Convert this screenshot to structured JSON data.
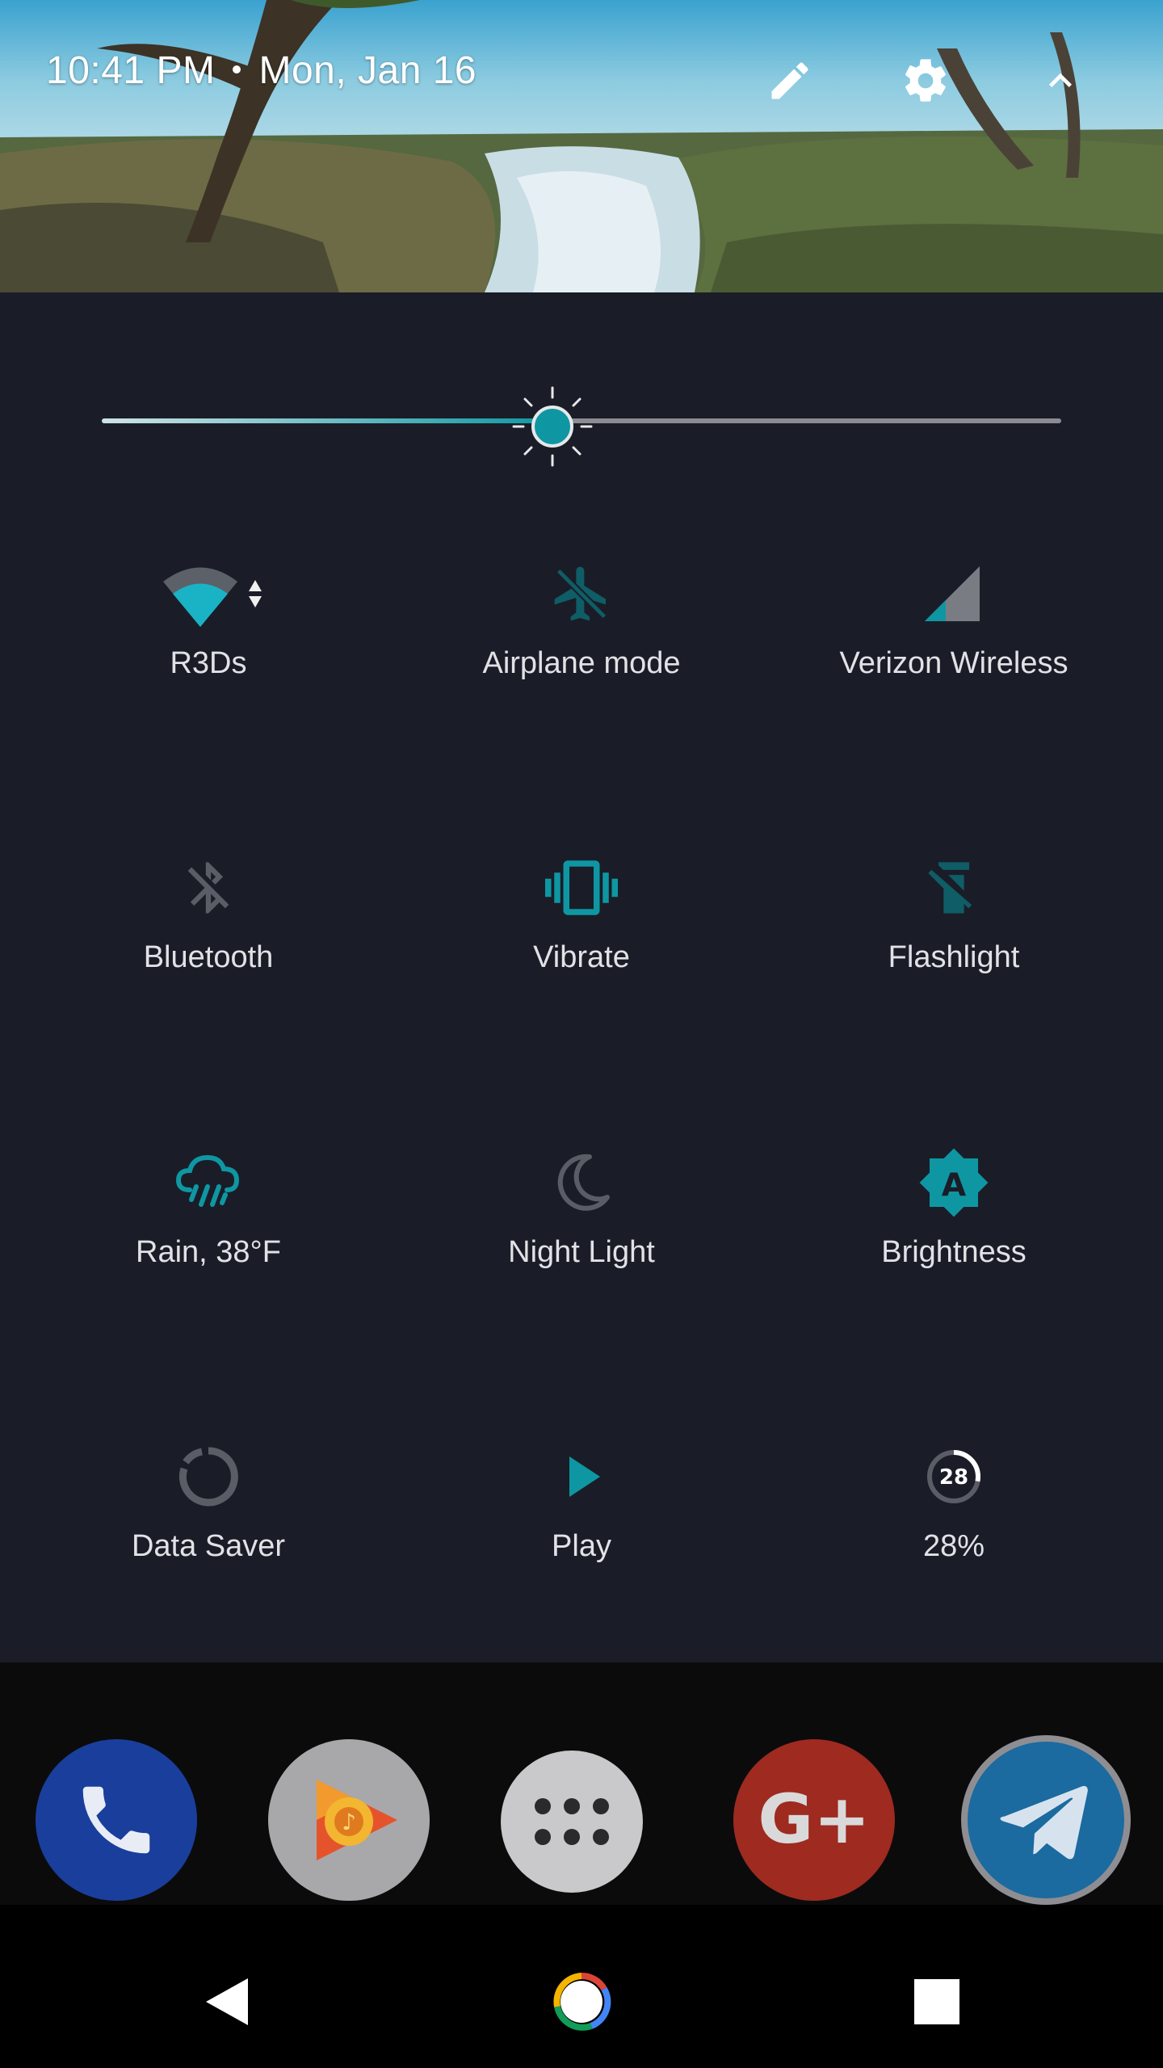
{
  "header": {
    "time": "10:41 PM",
    "date": "Mon, Jan 16",
    "buttons": {
      "edit": "edit-icon",
      "settings": "gear-icon",
      "collapse": "chevron-up-icon"
    }
  },
  "brightness_slider": {
    "level": 0.47,
    "icon": "sun-icon"
  },
  "tiles": [
    {
      "label": "R3Ds",
      "icon": "wifi-icon",
      "active": true
    },
    {
      "label": "Airplane mode",
      "icon": "airplane-icon",
      "active": false
    },
    {
      "label": "Verizon Wireless",
      "icon": "cell-signal-icon",
      "active": true
    },
    {
      "label": "Bluetooth",
      "icon": "bluetooth-off-icon",
      "active": false
    },
    {
      "label": "Vibrate",
      "icon": "vibrate-icon",
      "active": true
    },
    {
      "label": "Flashlight",
      "icon": "flashlight-icon",
      "active": false
    },
    {
      "label": "Rain, 38°F",
      "icon": "rain-cloud-icon",
      "active": true
    },
    {
      "label": "Night Light",
      "icon": "moon-icon",
      "active": false
    },
    {
      "label": "Brightness",
      "icon": "auto-brightness-icon",
      "active": true
    },
    {
      "label": "Data Saver",
      "icon": "data-saver-icon",
      "active": false
    },
    {
      "label": "Play",
      "icon": "play-icon",
      "active": true
    },
    {
      "label": "28%",
      "icon": "battery-circle-icon",
      "active": true,
      "battery_text": "28",
      "battery_level": 0.28
    }
  ],
  "dock": [
    "phone-icon",
    "play-music-icon",
    "app-drawer-icon",
    "google-plus-icon",
    "telegram-icon"
  ],
  "dock_text": {
    "google_plus": "G+"
  },
  "nav": [
    "back-icon",
    "home-icon",
    "recents-icon"
  ],
  "colors": {
    "accent": "#0e97a3",
    "panel": "#1a1d27",
    "inactive": "#5a5d66",
    "label": "#e1e2e6"
  }
}
